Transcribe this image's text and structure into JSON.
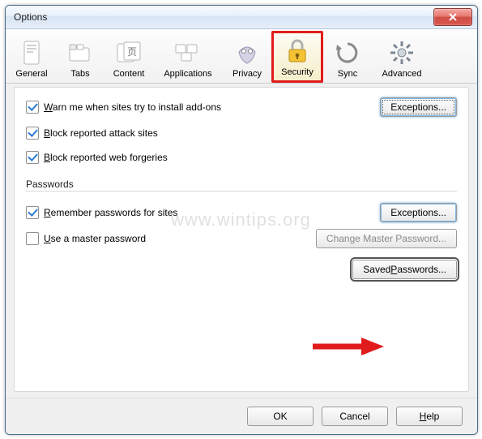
{
  "window": {
    "title": "Options"
  },
  "tabs": {
    "general": {
      "label": "General"
    },
    "tabs": {
      "label": "Tabs"
    },
    "content": {
      "label": "Content"
    },
    "applications": {
      "label": "Applications"
    },
    "privacy": {
      "label": "Privacy"
    },
    "security": {
      "label": "Security",
      "selected": true
    },
    "sync": {
      "label": "Sync"
    },
    "advanced": {
      "label": "Advanced"
    }
  },
  "security": {
    "warn_addons": {
      "checked": true,
      "label_pre": "",
      "hotkey": "W",
      "label_post": "arn me when sites try to install add-ons"
    },
    "block_attack": {
      "checked": true,
      "label_pre": "",
      "hotkey": "B",
      "label_post": "lock reported attack sites"
    },
    "block_forgeries": {
      "checked": true,
      "label_pre": "",
      "hotkey": "B",
      "label_post": "lock reported web forgeries"
    },
    "exceptions_top": "Exceptions...",
    "group_label": "Passwords",
    "remember": {
      "checked": true,
      "label_pre": "",
      "hotkey": "R",
      "label_post": "emember passwords for sites"
    },
    "master": {
      "checked": false,
      "label_pre": "",
      "hotkey": "U",
      "label_post": "se a master password"
    },
    "exceptions_pw": "Exceptions...",
    "change_master": "Change Master Password...",
    "saved_passwords_pre": "Saved ",
    "saved_passwords_hot": "P",
    "saved_passwords_post": "asswords..."
  },
  "buttons": {
    "ok": "OK",
    "cancel": "Cancel",
    "help_hot": "H",
    "help_post": "elp"
  },
  "watermark": "www.wintips.org"
}
